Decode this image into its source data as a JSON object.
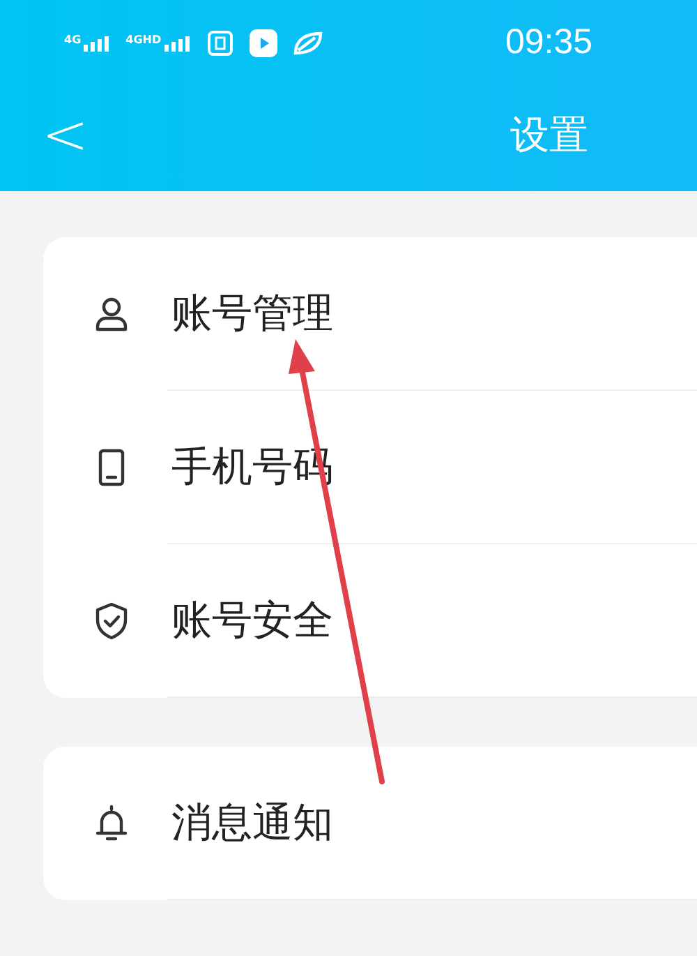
{
  "status_bar": {
    "signals": [
      {
        "label": "4G"
      },
      {
        "label": "4GHD"
      }
    ],
    "time": "09:35"
  },
  "header": {
    "back": "<",
    "title": "设置"
  },
  "groups": [
    {
      "items": [
        {
          "kind": "person",
          "label": "账号管理"
        },
        {
          "kind": "phone",
          "label": "手机号码"
        },
        {
          "kind": "shield",
          "label": "账号安全"
        }
      ]
    },
    {
      "items": [
        {
          "kind": "bell",
          "label": "消息通知"
        }
      ]
    }
  ]
}
